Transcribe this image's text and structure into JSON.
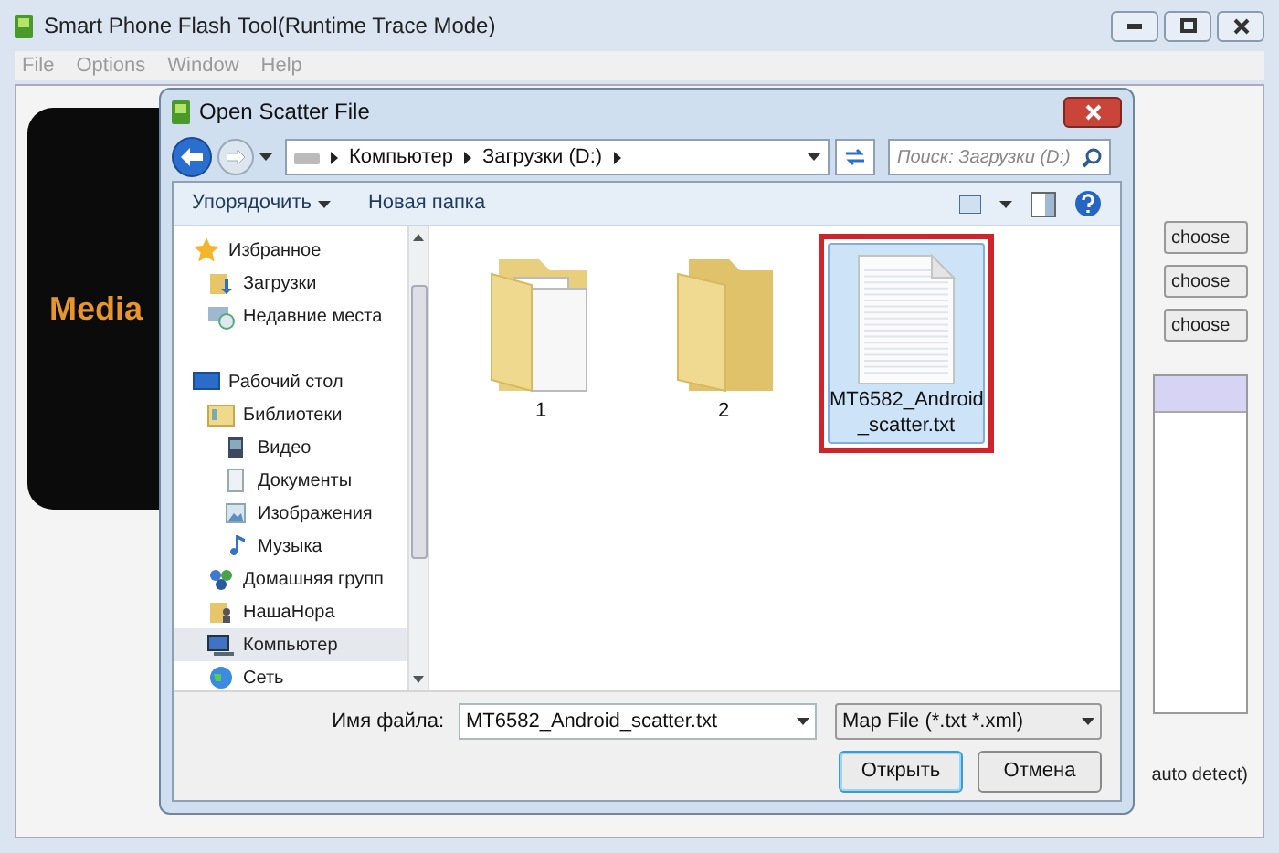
{
  "app": {
    "title": "Smart Phone Flash Tool(Runtime Trace Mode)",
    "menu": [
      "File",
      "Options",
      "Window",
      "Help"
    ],
    "phone_logo": "Media",
    "choose_buttons": [
      "choose",
      "choose",
      "choose"
    ],
    "status_text": "auto detect)"
  },
  "dialog": {
    "title": "Open Scatter File",
    "breadcrumb": [
      "Компьютер",
      "Загрузки (D:)"
    ],
    "search": {
      "placeholder": "Поиск: Загрузки (D:)"
    },
    "toolbar": {
      "organize": "Упорядочить",
      "new_folder": "Новая папка"
    },
    "sidebar": [
      {
        "label": "Избранное",
        "kind": "star",
        "selected": false,
        "children": [
          {
            "label": "Загрузки",
            "kind": "downloads",
            "selected": false
          },
          {
            "label": "Недавние места",
            "kind": "recent",
            "selected": false
          }
        ]
      },
      {
        "label": "Рабочий стол",
        "kind": "desktop",
        "selected": false,
        "children": [
          {
            "label": "Библиотеки",
            "kind": "library",
            "selected": false,
            "children": [
              {
                "label": "Видео",
                "kind": "video",
                "selected": false
              },
              {
                "label": "Документы",
                "kind": "docs",
                "selected": false
              },
              {
                "label": "Изображения",
                "kind": "images",
                "selected": false
              },
              {
                "label": "Музыка",
                "kind": "music",
                "selected": false
              }
            ]
          },
          {
            "label": "Домашняя групп",
            "kind": "homegroup",
            "selected": false
          },
          {
            "label": "НашаНора",
            "kind": "user",
            "selected": false
          },
          {
            "label": "Компьютер",
            "kind": "computer",
            "selected": true
          },
          {
            "label": "Сеть",
            "kind": "network",
            "selected": false
          }
        ]
      }
    ],
    "files": [
      {
        "name": "1",
        "kind": "folder_docs",
        "selected": false,
        "highlighted": false
      },
      {
        "name": "2",
        "kind": "folder",
        "selected": false,
        "highlighted": false
      },
      {
        "name": "MT6582_Android _scatter.txt",
        "kind": "text",
        "selected": true,
        "highlighted": true
      }
    ],
    "filename_label": "Имя файла:",
    "filename": "MT6582_Android_scatter.txt",
    "filetype": "Map File (*.txt *.xml)",
    "buttons": [
      {
        "label": "Открыть",
        "default": true
      },
      {
        "label": "Отмена",
        "default": false
      }
    ]
  }
}
